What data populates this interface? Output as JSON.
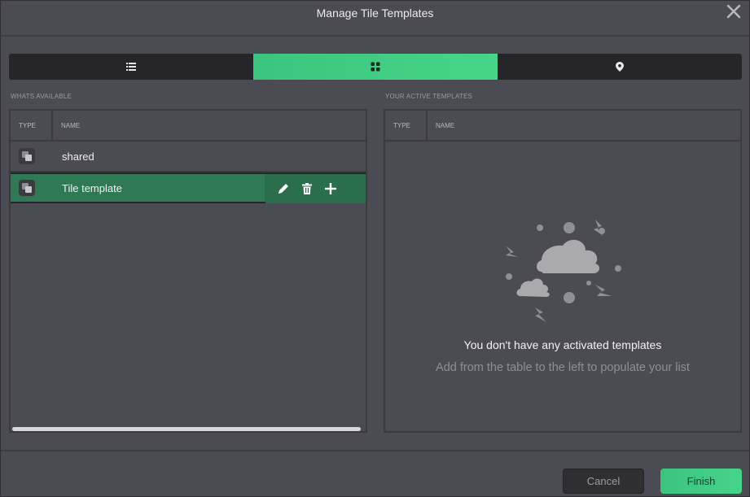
{
  "dialog": {
    "title": "Manage Tile Templates"
  },
  "tabs": [
    {
      "icon": "list-icon",
      "active": false
    },
    {
      "icon": "grid-icon",
      "active": true
    },
    {
      "icon": "map-pin-icon",
      "active": false
    }
  ],
  "available": {
    "label": "WHATS AVAILABLE",
    "columns": {
      "type": "TYPE",
      "name": "NAME"
    },
    "rows": [
      {
        "icon": "shared-tile-icon",
        "name": "shared",
        "selected": false
      },
      {
        "icon": "shared-tile-icon",
        "name": "Tile template",
        "selected": true
      }
    ],
    "row_actions": [
      "edit-icon",
      "delete-icon",
      "add-icon"
    ]
  },
  "active": {
    "label": "YOUR ACTIVE TEMPLATES",
    "columns": {
      "type": "TYPE",
      "name": "NAME"
    },
    "empty_title": "You don't have any activated templates",
    "empty_subtitle": "Add from the table to the left to populate your list"
  },
  "footer": {
    "cancel_label": "Cancel",
    "finish_label": "Finish"
  },
  "colors": {
    "accent": "#3cc47e",
    "selected_row": "#2f7a55",
    "background": "#4b4b53"
  }
}
